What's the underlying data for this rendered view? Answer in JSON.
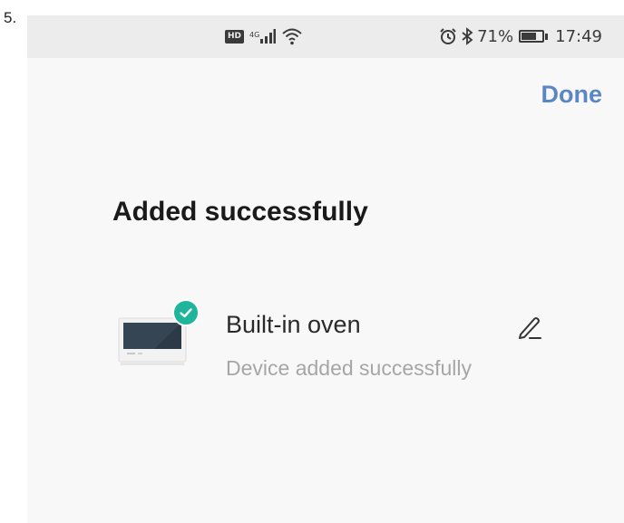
{
  "step_label": "5.",
  "status_bar": {
    "hd_badge": "HD",
    "network_type": "4G",
    "battery_percent": "71%",
    "battery_level": 0.71,
    "time": "17:49",
    "icons": [
      "hd-icon",
      "cell-signal-icon",
      "wifi-icon",
      "alarm-icon",
      "bluetooth-icon",
      "battery-icon"
    ]
  },
  "header": {
    "done_label": "Done",
    "accent_color": "#5a86c6"
  },
  "title": "Added successfully",
  "device": {
    "name": "Built-in oven",
    "status": "Device added successfully",
    "image_icon": "oven-icon",
    "badge_icon": "check-icon",
    "badge_color": "#1fb59a",
    "edit_icon": "pencil-icon"
  }
}
